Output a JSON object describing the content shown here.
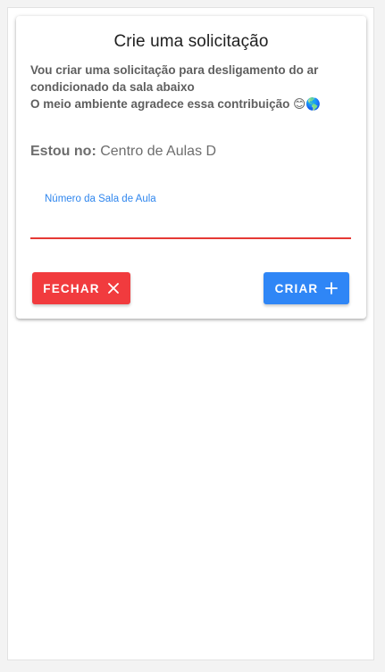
{
  "dialog": {
    "title": "Crie uma solicitação",
    "description": {
      "line1": "Vou criar uma solicitação para desligamento do ar",
      "line2": "condicionado da sala abaixo",
      "line3": "O meio ambiente agradece essa contribuição",
      "emoji_smile": "😊",
      "emoji_globe": "🌎"
    },
    "location": {
      "label": "Estou no:",
      "value": "Centro de Aulas D"
    },
    "room_field": {
      "label": "Número da Sala de Aula",
      "value": ""
    },
    "buttons": {
      "close_label": "FECHAR",
      "close_icon": "close-icon",
      "create_label": "CRIAR",
      "create_icon": "plus-icon"
    }
  },
  "colors": {
    "close_button": "#f13b3e",
    "create_button": "#2f86f6",
    "field_label": "#2f86ee",
    "field_underline_error": "#e53935"
  }
}
